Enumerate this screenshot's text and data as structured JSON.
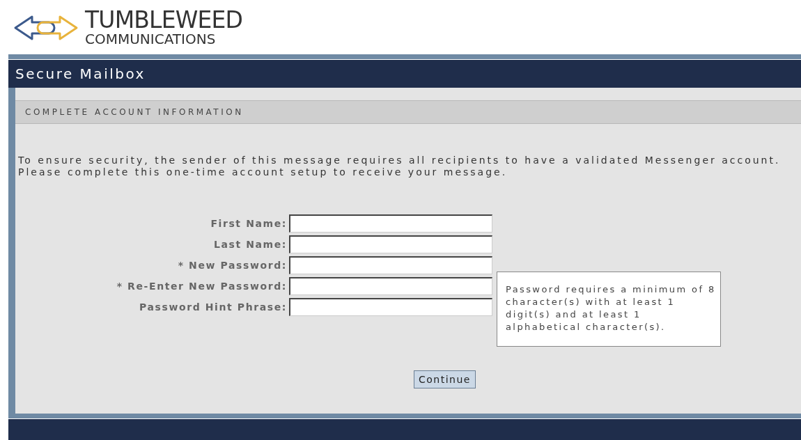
{
  "logo": {
    "name": "TUMBLEWEED",
    "tagline": "COMMUNICATIONS"
  },
  "header": {
    "title": "Secure Mailbox"
  },
  "section": {
    "title": "COMPLETE ACCOUNT INFORMATION"
  },
  "intro": [
    "To ensure security, the sender of this message requires all recipients to have a validated Messenger account.",
    "Please complete this one-time account setup to receive your message."
  ],
  "fields": [
    {
      "label": "First Name:"
    },
    {
      "label": "Last Name:"
    },
    {
      "label": "* New Password:"
    },
    {
      "label": "* Re-Enter New Password:"
    },
    {
      "label": "Password Hint Phrase:"
    }
  ],
  "hint": "Password requires a minimum of 8 character(s) with at least 1 digit(s) and at least 1 alphabetical character(s).",
  "button": "Continue"
}
